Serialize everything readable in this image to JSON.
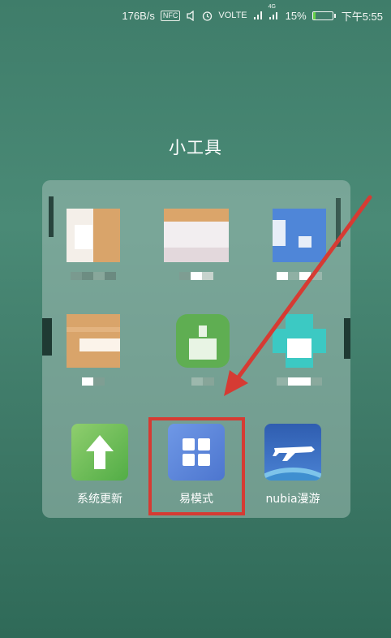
{
  "status_bar": {
    "net_speed": "176B/s",
    "nfc": "NFC",
    "volte": "VOLTE",
    "network_type": "4G",
    "battery_percent": "15%",
    "battery_level": 0.15,
    "time": "下午5:55"
  },
  "folder": {
    "title": "小工具",
    "apps": [
      {
        "label": "系统更新",
        "icon": "arrow-up-icon"
      },
      {
        "label": "易模式",
        "icon": "grid-four-icon"
      },
      {
        "label": "nubia漫游",
        "icon": "airplane-icon"
      }
    ]
  },
  "annotation": {
    "color": "#d63b33"
  }
}
